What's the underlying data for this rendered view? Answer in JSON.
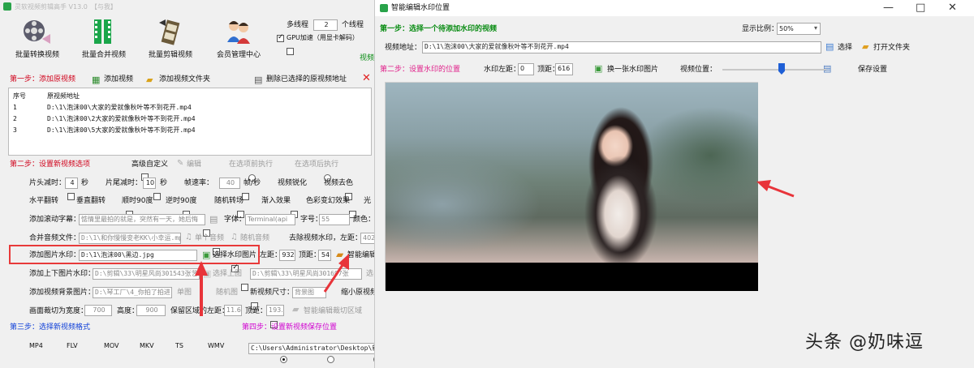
{
  "left_window": {
    "title": "灵软视频剪辑高手 V13.0",
    "title_extra": "【与我】",
    "toolbar": [
      {
        "label": "批量转换视频",
        "icon": "film-reel-icon"
      },
      {
        "label": "批量合并视频",
        "icon": "merge-film-icon"
      },
      {
        "label": "批量剪辑视频",
        "icon": "edit-film-icon"
      },
      {
        "label": "会员管理中心",
        "icon": "members-icon"
      }
    ],
    "multithread_label": "多线程",
    "thread_count": "2",
    "thread_unit": "个线程",
    "gpu_label": "GPU加速（用显卡解码）",
    "video_tag": "视频",
    "step1": {
      "title": "第一步：添加原视频",
      "add_video": "添加视频",
      "add_folder": "添加视频文件夹",
      "delete_selected": "删除已选择的原视频地址",
      "columns": [
        "序号",
        "原视频地址"
      ],
      "rows": [
        [
          "1",
          "D:\\1\\泡沫00\\大家的爱就像秋叶等不到花开.mp4"
        ],
        [
          "2",
          "D:\\1\\泡沫00\\2大家的爱就像秋叶等不到花开.mp4"
        ],
        [
          "3",
          "D:\\1\\泡沫00\\5大家的爱就像秋叶等不到花开.mp4"
        ]
      ]
    },
    "step2": {
      "title": "第二步：设置新视频选项",
      "advanced_custom": "高级自定义",
      "edit": "编辑",
      "exec_before": "在选项前执行",
      "exec_after": "在选项后执行",
      "row1": {
        "head_cut": "片头减时：",
        "head_value": "4",
        "sec1": "秒",
        "tail_cut": "片尾减时：",
        "tail_value": "10",
        "sec2": "秒",
        "frame_drop": "帧速率：",
        "frame_value": "40",
        "frame_unit": "帧/秒",
        "sharpen": "视频锐化",
        "decolor": "视频去色"
      },
      "row2": {
        "hflip": "水平翻转",
        "vflip": "垂直翻转",
        "rot90": "顺时90度",
        "rot90ccw": "逆时90度",
        "random_transition": "随机转场",
        "fade": "渐入效果",
        "color_shift": "色彩变幻效果",
        "light": "光"
      },
      "row3": {
        "scroll_caption": "添加滚动字幕：",
        "scroll_text": "惦情里最拍的就是，突然有一天，她后悔",
        "font_label": "字体：",
        "font_value": "Terminal(api",
        "size_label": "字号：",
        "size_value": "55",
        "color_label": "颜色："
      },
      "row4": {
        "merge_audio": "合并音频文件：",
        "audio_path": "D:\\1\\和你慢慢变老KK\\小幸运.mp",
        "single_audio": "单个音频",
        "random_audio": "随机音频",
        "remove_watermark": "去除视频水印，左距：",
        "remove_left": "402"
      },
      "row5": {
        "add_image_watermark": "添加图片水印：",
        "watermark_path": "D:\\1\\泡沫00\\黑边.jpg",
        "select_image": "选择水印图片",
        "left_label": "左距：",
        "left_value": "932",
        "top_label": "顶距：",
        "top_value": "54",
        "smart_edit": "智能编辑"
      },
      "row6": {
        "topbottom_watermark": "添加上下图片水印：",
        "topbottom_path": "D:\\剪辑\\33\\明星风尚301543张艺",
        "select_top": "选择上图",
        "bottom_path": "D:\\剪辑\\33\\明星风尚301697张",
        "select_bottom": "选"
      },
      "row7": {
        "bg_image": "添加视频背景图片：",
        "bg_path": "D:\\琴工厂\\4_你拍了拍进",
        "single_img": "单图",
        "random_img": "随机图",
        "new_size": "新视频尺寸：",
        "size_select": "背景图",
        "shrink": "缩小原视频到"
      },
      "row8": {
        "crop": "画面裁切为宽度：",
        "crop_w": "700",
        "height_label": "高度：",
        "crop_h": "900",
        "keep_left": "保留区域的左距：",
        "keep_left_value": "11.66",
        "top_label": "顶距：",
        "top_value": "193.3",
        "smart_crop": "智能编辑裁切区域"
      }
    },
    "step3": {
      "title": "第三步：选择新视频格式",
      "formats": [
        "MP4",
        "FLV",
        "MOV",
        "MKV",
        "TS",
        "WMV"
      ],
      "selected": "MP4"
    },
    "step4": {
      "title": "第四步：设置新视频保存位置",
      "path": "C:\\Users\\Administrator\\Desktop\\新建"
    }
  },
  "right_window": {
    "title": "智能编辑水印位置",
    "step1": "第一步：选择一个待添加水印的视频",
    "zoom_label": "显示比例：",
    "zoom_value": "50%",
    "video_path_label": "视频地址：",
    "video_path": "D:\\1\\泡沫00\\大家的爱就像秋叶等不到花开.mp4",
    "select": "选择",
    "open_folder": "打开文件夹",
    "step2": "第二步：设置水印的位置",
    "left_label": "水印左距：",
    "left_value": "0",
    "top_label": "顶距：",
    "top_value": "616",
    "change_image": "换一张水印图片",
    "position_label": "视频位置：",
    "save_settings": "保存设置",
    "position_value": 0.57,
    "window_controls": [
      "—",
      "□",
      "✕"
    ]
  },
  "overlay": {
    "watermark_text": "头条 @奶味逗",
    "arrow_color": "#e8343a",
    "highlight_color": "#e83a3a"
  }
}
